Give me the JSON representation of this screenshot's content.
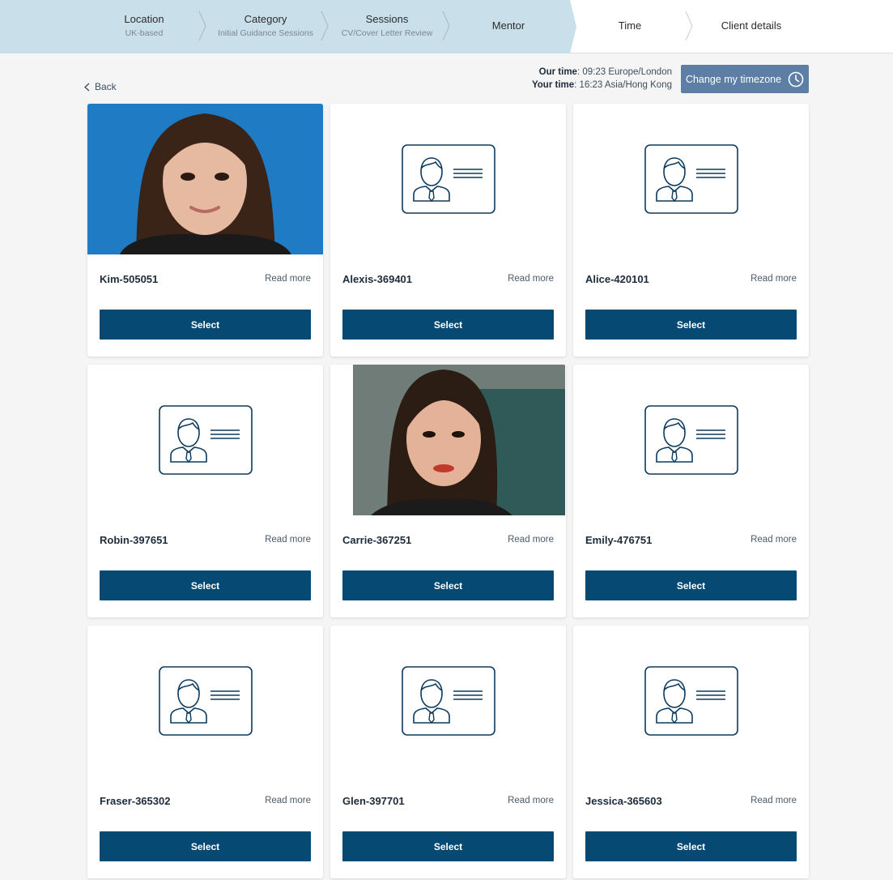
{
  "stepper": {
    "steps": [
      {
        "title": "Location",
        "sub": "UK-based"
      },
      {
        "title": "Category",
        "sub": "Initial Guidance Sessions"
      },
      {
        "title": "Sessions",
        "sub": "CV/Cover Letter Review"
      },
      {
        "title": "Mentor",
        "sub": ""
      },
      {
        "title": "Time",
        "sub": ""
      },
      {
        "title": "Client details",
        "sub": ""
      }
    ],
    "done_color": "#c9e0ea"
  },
  "nav": {
    "back_label": "Back"
  },
  "times": {
    "our_label": "Our time",
    "our_value": ": 09:23 Europe/London",
    "your_label": "Your time",
    "your_value": ": 16:23 Asia/Hong Kong",
    "tz_button": "Change my timezone"
  },
  "mentors": [
    {
      "name": "Kim-505051",
      "read_more": "Read more",
      "select": "Select",
      "avatar": "photo"
    },
    {
      "name": "Alexis-369401",
      "read_more": "Read more",
      "select": "Select",
      "avatar": "id-card-icon"
    },
    {
      "name": "Alice-420101",
      "read_more": "Read more",
      "select": "Select",
      "avatar": "id-card-icon"
    },
    {
      "name": "Robin-397651",
      "read_more": "Read more",
      "select": "Select",
      "avatar": "id-card-icon"
    },
    {
      "name": "Carrie-367251",
      "read_more": "Read more",
      "select": "Select",
      "avatar": "photo"
    },
    {
      "name": "Emily-476751",
      "read_more": "Read more",
      "select": "Select",
      "avatar": "id-card-icon"
    },
    {
      "name": "Fraser-365302",
      "read_more": "Read more",
      "select": "Select",
      "avatar": "id-card-icon"
    },
    {
      "name": "Glen-397701",
      "read_more": "Read more",
      "select": "Select",
      "avatar": "id-card-icon"
    },
    {
      "name": "Jessica-365603",
      "read_more": "Read more",
      "select": "Select",
      "avatar": "id-card-icon"
    }
  ],
  "colors": {
    "select_button": "#064a74",
    "tz_button": "#5e7fa5",
    "icon_stroke": "#0b3a5e"
  }
}
